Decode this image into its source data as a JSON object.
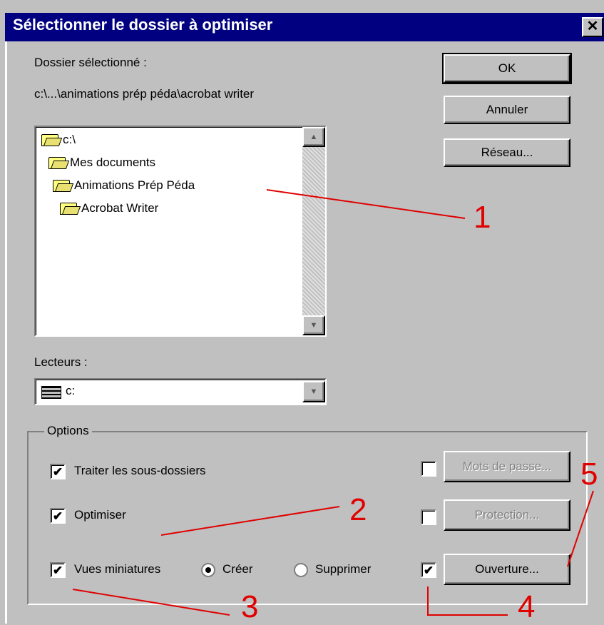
{
  "dialog": {
    "title": "Sélectionner le dossier à optimiser",
    "close_glyph": "✕"
  },
  "selected_folder": {
    "label": "Dossier sélectionné :",
    "path": "c:\\...\\animations prép péda\\acrobat writer"
  },
  "buttons": {
    "ok": "OK",
    "cancel": "Annuler",
    "network": "Réseau..."
  },
  "folder_tree": [
    {
      "label": "c:\\",
      "icon": "open-folder-icon"
    },
    {
      "label": "Mes documents",
      "icon": "open-folder-icon"
    },
    {
      "label": "Animations Prép Péda",
      "icon": "open-folder-icon"
    },
    {
      "label": "Acrobat Writer",
      "icon": "open-folder-icon"
    }
  ],
  "drives": {
    "label": "Lecteurs :",
    "selected": "c:",
    "icon": "hard-drive-icon"
  },
  "options": {
    "group_label": "Options",
    "process_subfolders": {
      "label": "Traiter les sous-dossiers",
      "checked": true
    },
    "optimize": {
      "label": "Optimiser",
      "checked": true
    },
    "thumbnails": {
      "label": "Vues miniatures",
      "checked": true
    },
    "create": {
      "label": "Créer",
      "selected": true
    },
    "delete": {
      "label": "Supprimer",
      "selected": false
    },
    "password_check": {
      "checked": false
    },
    "password_button": "Mots de passe...",
    "protection_check": {
      "checked": false
    },
    "protection_button": "Protection...",
    "open_check": {
      "checked": true
    },
    "open_button": "Ouverture...",
    "check_glyph": "✔"
  },
  "annotations": {
    "n1": "1",
    "n2": "2",
    "n3": "3",
    "n4": "4",
    "n5": "5",
    "color": "#e00000"
  }
}
